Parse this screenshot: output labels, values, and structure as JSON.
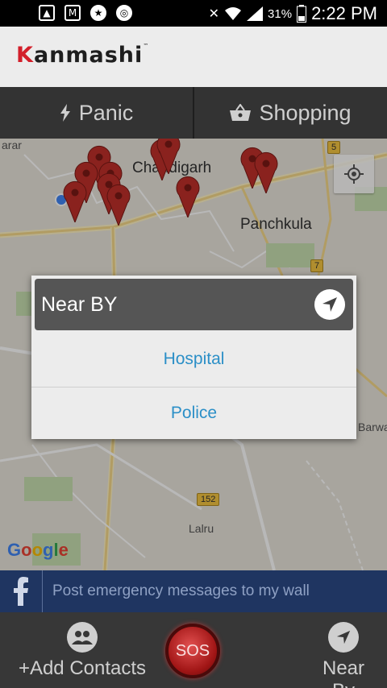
{
  "status_bar": {
    "battery_percent": "31%",
    "time": "2:22 PM"
  },
  "app": {
    "logo_text": "Kanmashi",
    "logo_tm": "TM"
  },
  "tabs": [
    {
      "label": "Panic",
      "icon": "bolt-icon"
    },
    {
      "label": "Shopping",
      "icon": "basket-icon"
    }
  ],
  "map": {
    "labels": {
      "chandigarh": "Chandigarh",
      "panchkula": "Panchkula",
      "zirakpur_fragment": "arar",
      "lalru": "Lalru",
      "barwala_fragment": "Barwa"
    },
    "shields": {
      "nh5": "5",
      "nh7": "7",
      "nh152": "152"
    },
    "attribution": "Google",
    "colors": {
      "google": [
        "#4285F4",
        "#EA4335",
        "#FBBC05",
        "#4285F4",
        "#34A853",
        "#EA4335"
      ]
    }
  },
  "dialog": {
    "title": "Near BY",
    "items": [
      "Hospital",
      "Police"
    ],
    "accent": "#2b8fc7"
  },
  "facebook_bar": {
    "text": "Post emergency messages to my wall"
  },
  "bottom_bar": {
    "add_contacts": "+Add Contacts",
    "sos": "SOS",
    "near_by": "Near By"
  }
}
